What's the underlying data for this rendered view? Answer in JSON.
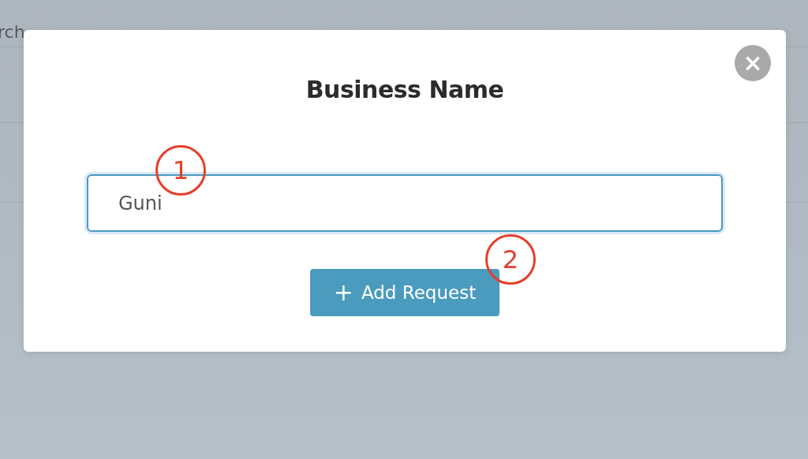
{
  "background": {
    "tabs": [
      {
        "label": "rch"
      }
    ]
  },
  "modal": {
    "title": "Business Name",
    "close_label": "×",
    "field": {
      "value": "Guni"
    },
    "button": {
      "icon": "+",
      "label": "Add Request"
    }
  },
  "annotations": [
    {
      "label": "1"
    },
    {
      "label": "2"
    }
  ]
}
